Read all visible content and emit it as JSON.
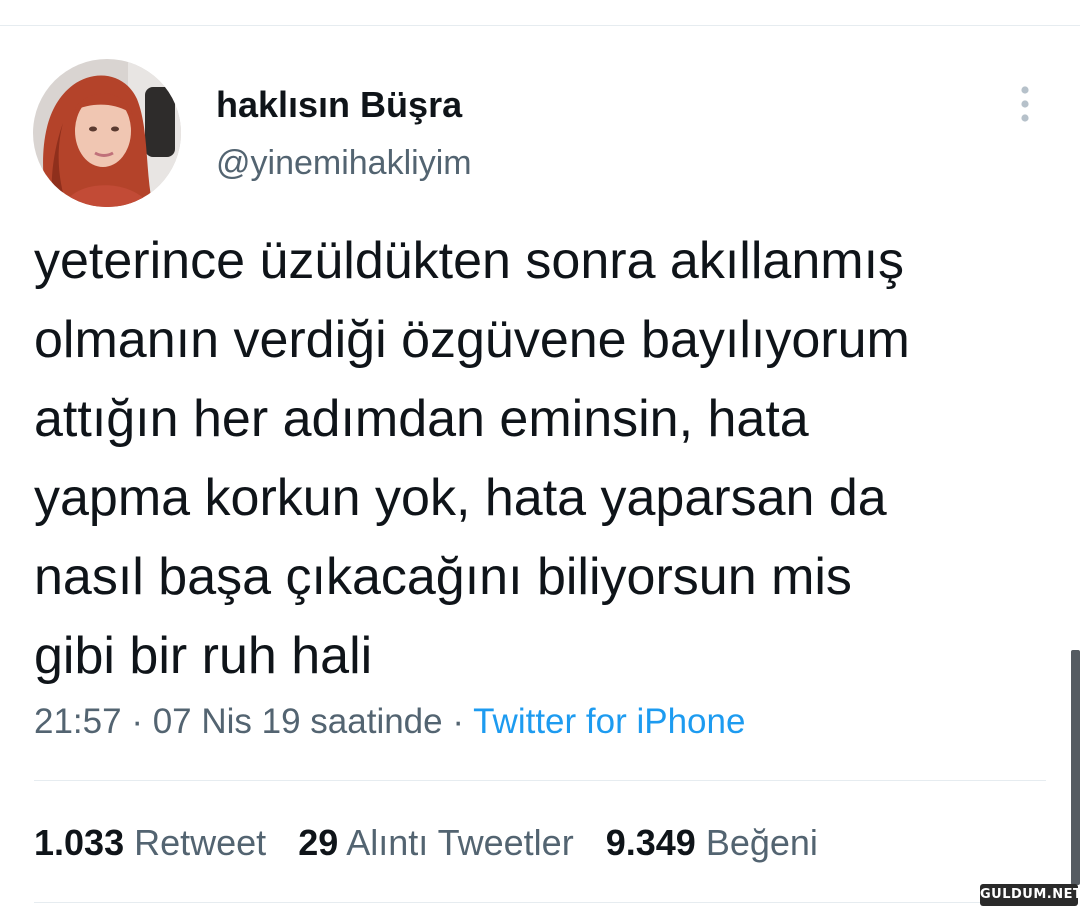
{
  "tweet": {
    "author": {
      "display_name": "haklısın Büşra",
      "handle": "@yinemihakliyim",
      "avatar_icon": "profile-photo"
    },
    "more_icon": "vertical-ellipsis-icon",
    "text_lines": [
      "yeterince üzüldükten sonra akıllanmış",
      "olmanın verdiği özgüvene bayılıyorum",
      "attığın her adımdan eminsin, hata",
      "yapma korkun yok, hata yaparsan da",
      "nasıl başa çıkacağını biliyorsun mis",
      "gibi bir ruh hali"
    ],
    "meta": {
      "time": "21:57",
      "separator": " · ",
      "date": "07 Nis 19 saatinde",
      "source": "Twitter for iPhone"
    },
    "stats": {
      "retweets": {
        "count": "1.033",
        "label": "Retweet"
      },
      "quotes": {
        "count": "29",
        "label": "Alıntı Tweetler"
      },
      "likes": {
        "count": "9.349",
        "label": "Beğeni"
      }
    }
  },
  "watermark": "GULDUM.NET",
  "colors": {
    "text_primary": "#0f1419",
    "text_secondary": "#536471",
    "link": "#1d9bf0",
    "divider": "#e6ecf0"
  }
}
